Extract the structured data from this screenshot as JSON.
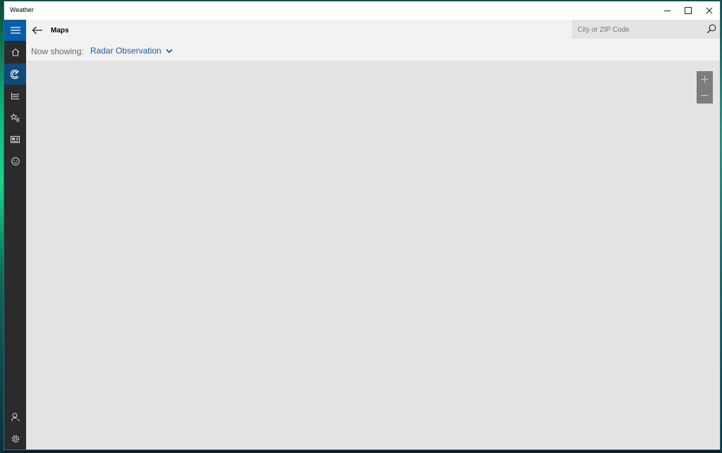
{
  "window": {
    "title": "Weather"
  },
  "controls": {
    "minimize_icon": "minimize-icon",
    "maximize_icon": "maximize-icon",
    "close_icon": "close-icon"
  },
  "sidebar": {
    "items": [
      {
        "icon": "hamburger-icon",
        "selected": false
      },
      {
        "icon": "home-icon",
        "selected": false
      },
      {
        "icon": "radar-icon",
        "selected": true
      },
      {
        "icon": "historical-chart-icon",
        "selected": false
      },
      {
        "icon": "places-star-icon",
        "selected": false
      },
      {
        "icon": "news-icon",
        "selected": false
      },
      {
        "icon": "smiley-icon",
        "selected": false
      },
      {
        "icon": "account-icon",
        "selected": false
      },
      {
        "icon": "settings-gear-icon",
        "selected": false
      }
    ],
    "accent_color": "#0a5ea8",
    "selected_color": "#0f4a7a",
    "background_color": "#2b2b2b"
  },
  "header": {
    "page_title": "Maps",
    "now_showing_label": "Now showing:",
    "layer_value": "Radar Observation",
    "layer_color": "#1a5f9e"
  },
  "search": {
    "placeholder": "City or ZIP Code",
    "icon": "search-icon"
  },
  "map": {
    "background_color": "#e4e4e4",
    "zoom_in_icon": "plus-icon",
    "zoom_out_icon": "minus-icon"
  }
}
